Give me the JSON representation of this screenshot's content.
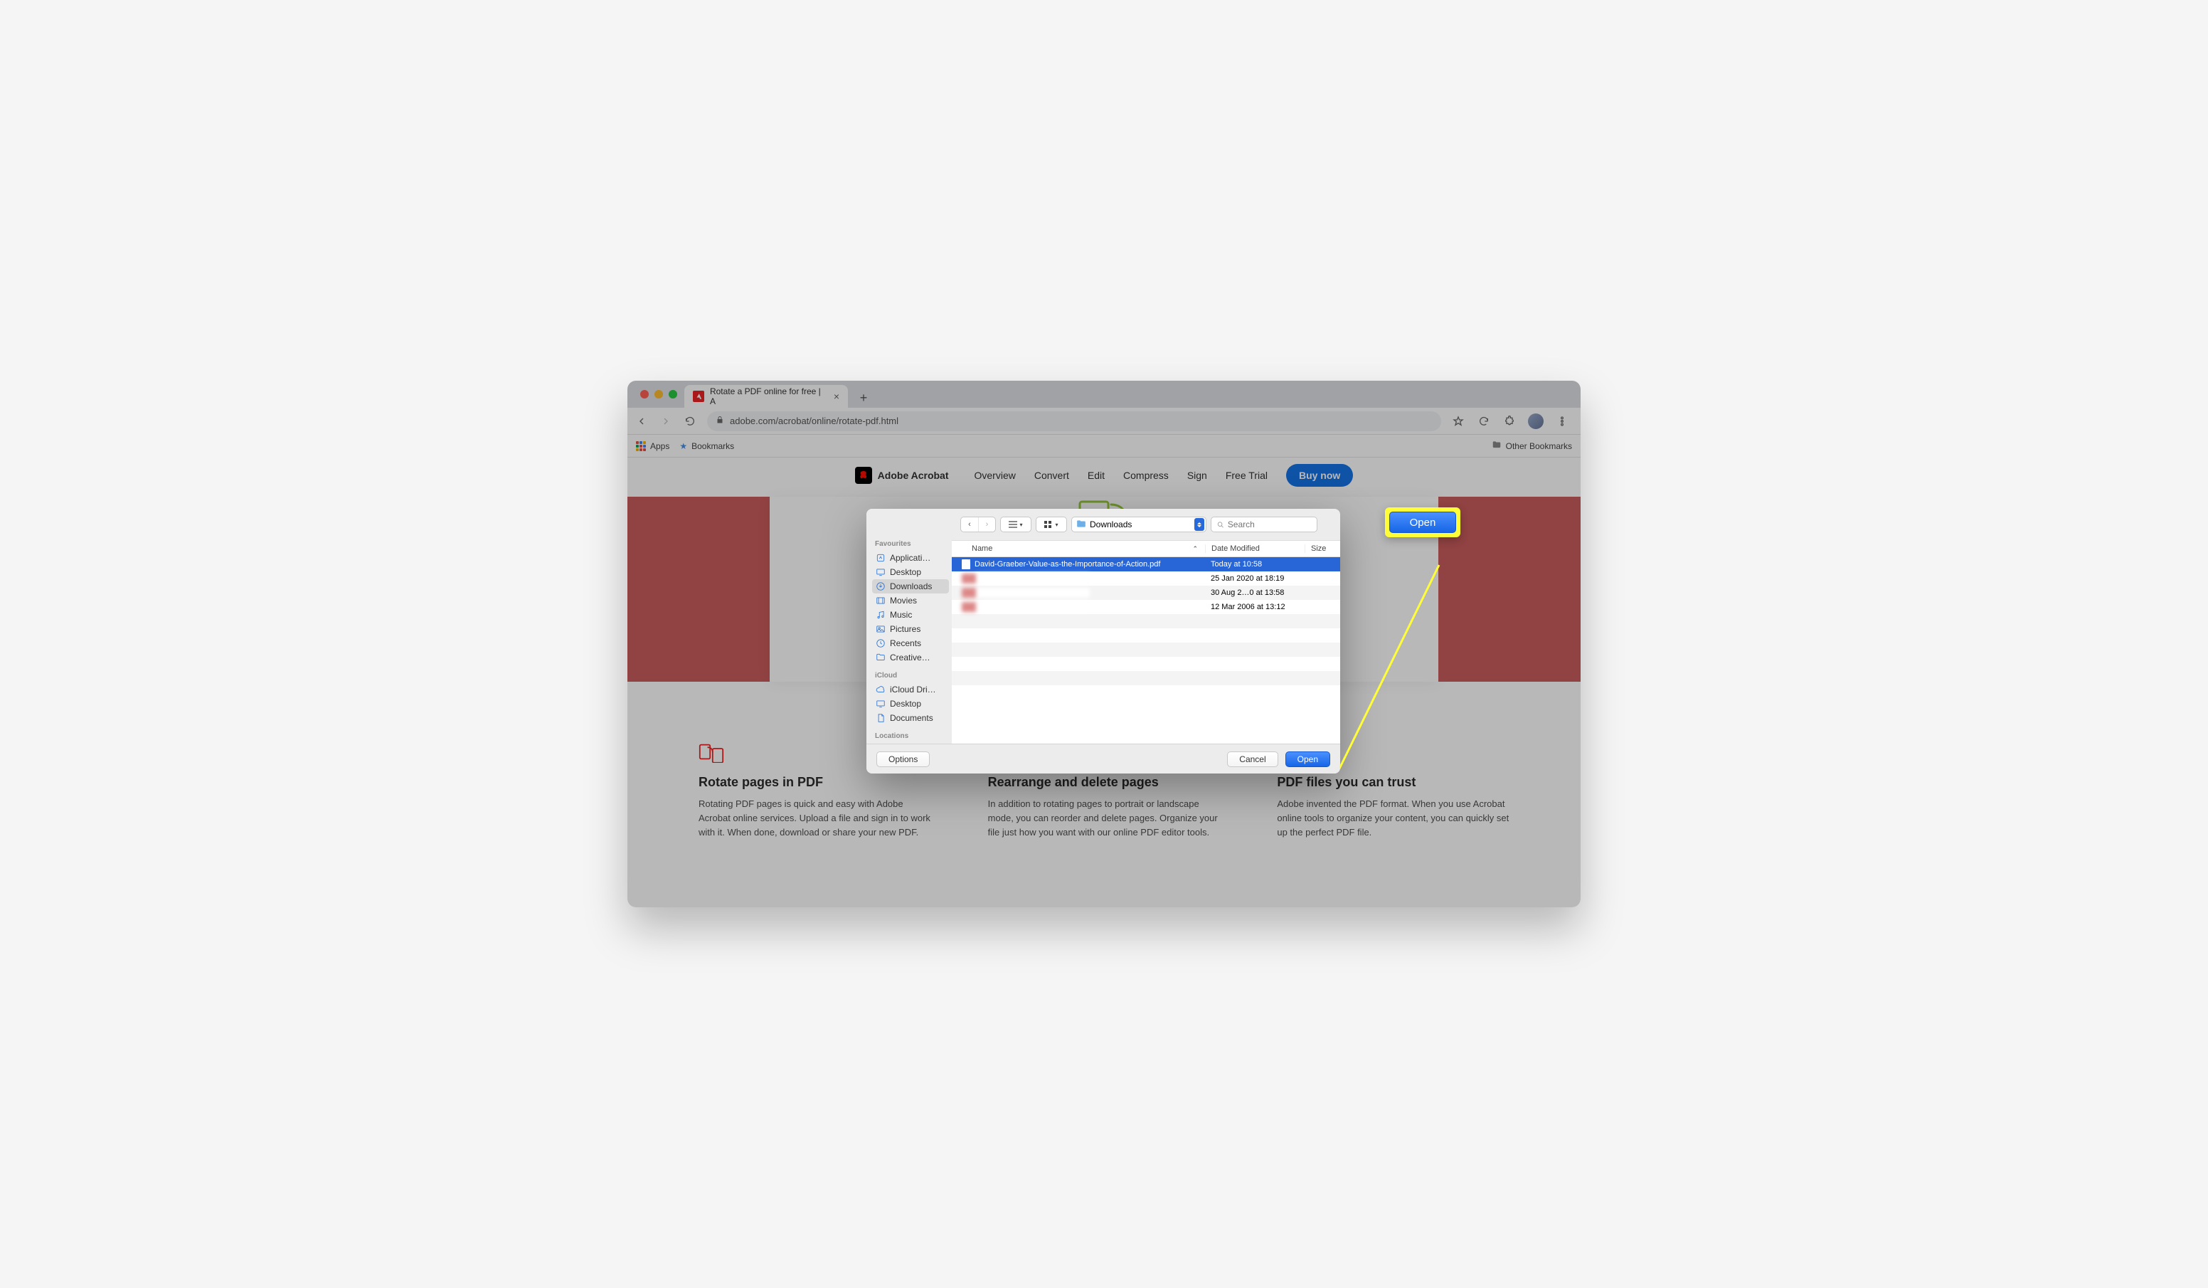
{
  "browser": {
    "tab_title": "Rotate a PDF online for free | A",
    "url_display": "adobe.com/acrobat/online/rotate-pdf.html",
    "apps_label": "Apps",
    "bookmarks_label": "Bookmarks",
    "other_bookmarks": "Other Bookmarks"
  },
  "adobe_nav": {
    "brand": "Adobe Acrobat",
    "items": [
      "Overview",
      "Convert",
      "Edit",
      "Compress",
      "Sign",
      "Free Trial"
    ],
    "buy": "Buy now"
  },
  "features": [
    {
      "title": "Rotate pages in PDF",
      "text": "Rotating PDF pages is quick and easy with Adobe Acrobat online services. Upload a file and sign in to work with it. When done, download or share your new PDF."
    },
    {
      "title": "Rearrange and delete pages",
      "text": "In addition to rotating pages to portrait or landscape mode, you can reorder and delete pages. Organize your file just how you want with our online PDF editor tools."
    },
    {
      "title": "PDF files you can trust",
      "text": "Adobe invented the PDF format. When you use Acrobat online tools to organize your content, you can quickly set up the perfect PDF file."
    }
  ],
  "dialog": {
    "location": "Downloads",
    "search_placeholder": "Search",
    "sidebar": {
      "favourites_label": "Favourites",
      "favourites": [
        "Applicati…",
        "Desktop",
        "Downloads",
        "Movies",
        "Music",
        "Pictures",
        "Recents",
        "Creative…"
      ],
      "icloud_label": "iCloud",
      "icloud": [
        "iCloud Dri…",
        "Desktop",
        "Documents"
      ],
      "locations_label": "Locations"
    },
    "columns": {
      "name": "Name",
      "modified": "Date Modified",
      "size": "Size"
    },
    "files": [
      {
        "name": "David-Graeber-Value-as-the-Importance-of-Action.pdf",
        "date": "Today at 10:58",
        "selected": true
      },
      {
        "name": "",
        "date": "25 Jan 2020 at 18:19",
        "blurred": true
      },
      {
        "name": "",
        "date": "30 Aug 2…0 at 13:58",
        "blurred": true
      },
      {
        "name": "",
        "date": "12 Mar 2006 at 13:12",
        "blurred": true
      }
    ],
    "options": "Options",
    "cancel": "Cancel",
    "open": "Open"
  },
  "callout": {
    "label": "Open"
  }
}
